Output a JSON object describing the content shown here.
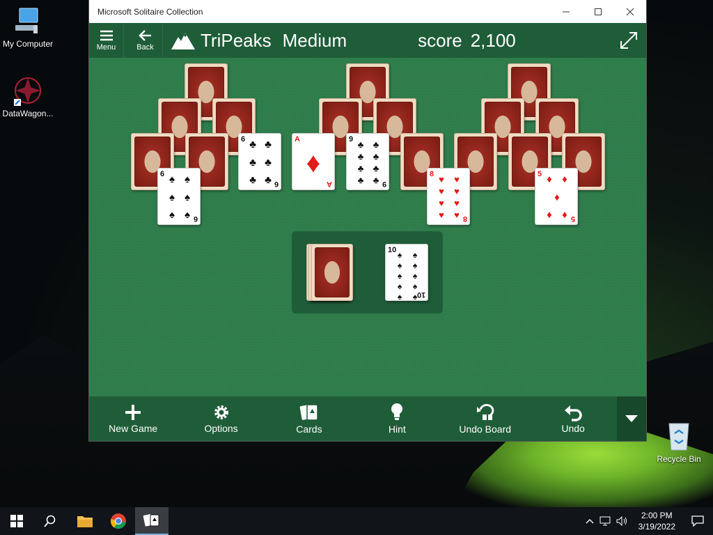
{
  "desktop": {
    "icons": [
      {
        "label": "My Computer",
        "icon": "computer-icon"
      },
      {
        "label": "DataWagon...",
        "icon": "datawagon-icon"
      },
      {
        "label": "Recycle Bin",
        "icon": "recycle-bin-icon"
      }
    ]
  },
  "window": {
    "title": "Microsoft Solitaire Collection",
    "controls": [
      "minimize",
      "maximize",
      "close"
    ]
  },
  "appbar": {
    "menu_label": "Menu",
    "back_label": "Back",
    "game_name": "TriPeaks",
    "difficulty": "Medium",
    "score_label": "score",
    "score_value": "2,100"
  },
  "board": {
    "face_up": [
      {
        "rank": "6",
        "suit": "♠",
        "color": "black"
      },
      {
        "rank": "6",
        "suit": "♣",
        "color": "black"
      },
      {
        "rank": "A",
        "suit": "♦",
        "color": "red"
      },
      {
        "rank": "9",
        "suit": "♣",
        "color": "black"
      },
      {
        "rank": "8",
        "suit": "♥",
        "color": "red"
      },
      {
        "rank": "5",
        "suit": "♦",
        "color": "red"
      }
    ],
    "waste": {
      "rank": "10",
      "suit": "♠",
      "color": "black"
    }
  },
  "toolbar": {
    "new_game": "New Game",
    "options": "Options",
    "cards": "Cards",
    "hint": "Hint",
    "undo_board": "Undo Board",
    "undo": "Undo"
  },
  "taskbar": {
    "time": "2:00 PM",
    "date": "3/19/2022"
  },
  "colors": {
    "felt": "#2f7c4b",
    "bar": "#1f5d39",
    "card_back": "#8d241a"
  }
}
